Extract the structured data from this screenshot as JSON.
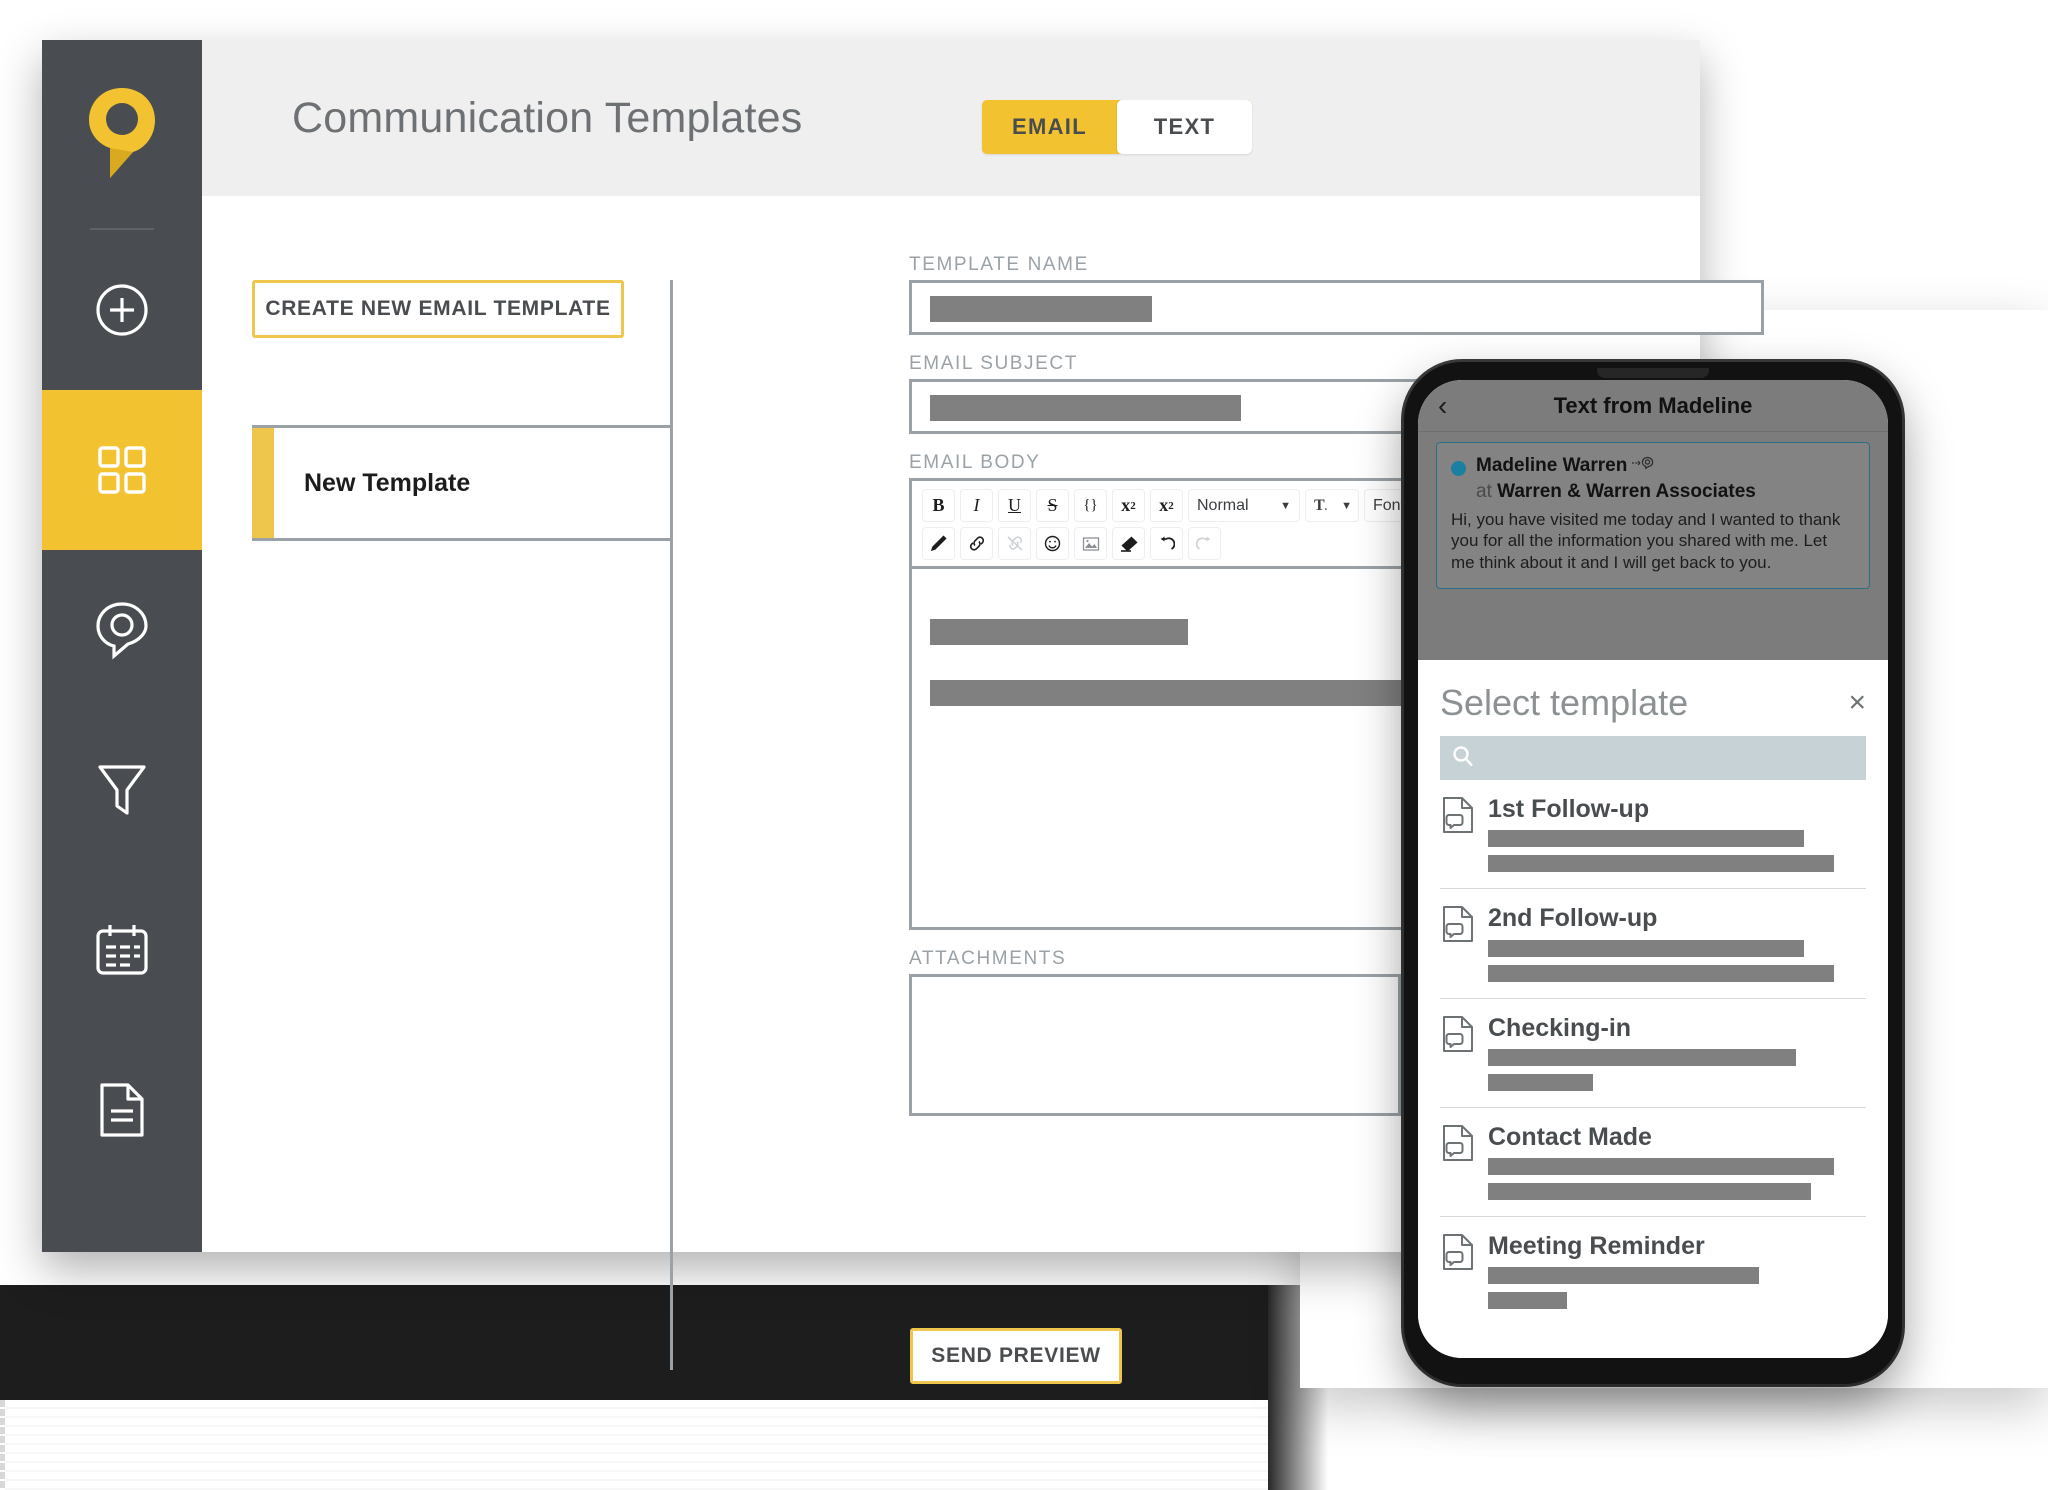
{
  "header": {
    "title": "Communication Templates",
    "toggle": {
      "email": "EMAIL",
      "text": "TEXT",
      "active": "EMAIL"
    }
  },
  "sidebar": {
    "logo_name": "app-logo-pin",
    "items": [
      {
        "icon": "plus-circle-icon",
        "active": false
      },
      {
        "icon": "grid-dashboard-icon",
        "active": true
      },
      {
        "icon": "location-pin-icon",
        "active": false
      },
      {
        "icon": "funnel-filter-icon",
        "active": false
      },
      {
        "icon": "calendar-icon",
        "active": false
      },
      {
        "icon": "document-icon",
        "active": false
      }
    ]
  },
  "templates_panel": {
    "create_button": "CREATE NEW EMAIL TEMPLATE",
    "items": [
      {
        "label": "New Template",
        "selected": true
      }
    ]
  },
  "form": {
    "template_name": {
      "label": "TEMPLATE NAME",
      "value": ""
    },
    "email_subject": {
      "label": "EMAIL SUBJECT",
      "value": ""
    },
    "email_body": {
      "label": "EMAIL BODY"
    },
    "attachments": {
      "label": "ATTACHMENTS",
      "value": ""
    },
    "send_preview_button": "SEND PREVIEW"
  },
  "editor_toolbar": {
    "row1": [
      {
        "name": "bold-icon",
        "glyph": "B",
        "style": "bold",
        "disabled": false
      },
      {
        "name": "italic-icon",
        "glyph": "I",
        "style": "italic",
        "disabled": false
      },
      {
        "name": "underline-icon",
        "glyph": "U",
        "style": "under",
        "disabled": false
      },
      {
        "name": "strikethrough-icon",
        "glyph": "S",
        "style": "strike",
        "disabled": false
      },
      {
        "name": "code-block-icon",
        "glyph": "{}",
        "style": "plain",
        "disabled": false
      },
      {
        "name": "superscript-icon",
        "glyph": "x²",
        "style": "plain",
        "disabled": false
      },
      {
        "name": "subscript-icon",
        "glyph": "x₂",
        "style": "plain",
        "disabled": false
      }
    ],
    "style_select": {
      "name": "paragraph-style-select",
      "value": "Normal"
    },
    "text_color": {
      "name": "text-color-icon",
      "glyph": "T"
    },
    "font_select": {
      "name": "font-family-select",
      "value": "Font"
    },
    "row1b": [
      {
        "name": "bulleted-list-icon",
        "disabled": false
      },
      {
        "name": "numbered-list-icon",
        "disabled": false
      },
      {
        "name": "indent-increase-icon",
        "disabled": true
      },
      {
        "name": "indent-decrease-icon",
        "disabled": true
      },
      {
        "name": "align-left-icon",
        "disabled": true
      }
    ],
    "row2": [
      {
        "name": "highlighter-pen-icon",
        "disabled": false
      },
      {
        "name": "insert-link-icon",
        "disabled": false
      },
      {
        "name": "remove-link-icon",
        "disabled": true
      },
      {
        "name": "emoji-icon",
        "disabled": false
      },
      {
        "name": "insert-image-icon",
        "disabled": false
      },
      {
        "name": "clear-format-eraser-icon",
        "disabled": false
      },
      {
        "name": "undo-icon",
        "disabled": false
      },
      {
        "name": "redo-icon",
        "disabled": true
      }
    ]
  },
  "phone": {
    "header_title": "Text from Madeline",
    "back_label": "‹",
    "message": {
      "sender": "Madeline Warren",
      "at_word": "at",
      "company": "Warren & Warren Associates",
      "body": "Hi, you have visited me today and I wanted to thank you for all the information you shared with me. Let me think about it and I will get back to you."
    },
    "sheet": {
      "title": "Select template",
      "close_label": "×",
      "search_placeholder": "",
      "templates": [
        {
          "name": "1st Follow-up",
          "bar1": 84,
          "bar2": 92
        },
        {
          "name": "2nd Follow-up",
          "bar1": 84,
          "bar2": 92
        },
        {
          "name": "Checking-in",
          "bar1": 82,
          "bar2": 28
        },
        {
          "name": "Contact Made",
          "bar1": 92,
          "bar2": 86
        },
        {
          "name": "Meeting Reminder",
          "bar1": 72,
          "bar2": 21
        }
      ]
    }
  },
  "colors": {
    "brand_yellow": "#f2c230",
    "brand_yellow_border": "#edc64b",
    "sidebar_dark": "#494d52",
    "header_grey": "#efefef",
    "field_border": "#9aa2a7",
    "placeholder_grey": "#808080",
    "phone_chat_grey": "#7c7c7c",
    "accent_blue": "#1a7fa0"
  }
}
